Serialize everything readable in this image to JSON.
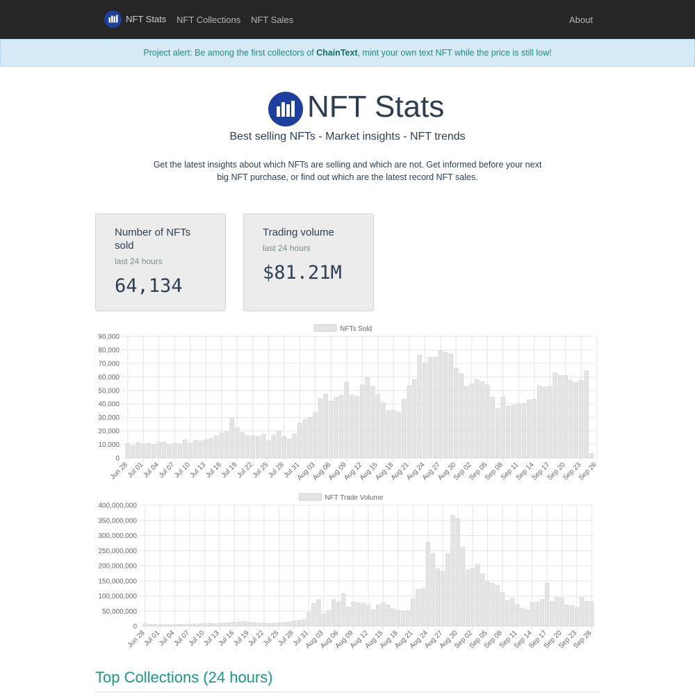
{
  "navbar": {
    "brand": "NFT Stats",
    "links": [
      "NFT Collections",
      "NFT Sales"
    ],
    "about": "About"
  },
  "alert": {
    "prefix": "Project alert: Be among the first collectors of ",
    "highlight": "ChainText",
    "suffix": ", mint your own text NFT while the price is still low!"
  },
  "hero": {
    "title": "NFT Stats",
    "subtitle": "Best selling NFTs - Market insights - NFT trends",
    "description": "Get the latest insights about which NFTs are selling and which are not. Get informed before your next big NFT purchase, or find out which are the latest record NFT sales."
  },
  "cards": [
    {
      "title": "Number of NFTs sold",
      "subtitle": "last 24 hours",
      "value": "64,134"
    },
    {
      "title": "Trading volume",
      "subtitle": "last 24 hours",
      "value": "$81.21M"
    }
  ],
  "colors": {
    "navbar": "#262626",
    "accent": "#18998a",
    "alert_bg": "#d5eaf6",
    "bar_fill": "#e4e4e4",
    "bar_stroke": "#d2d2d2"
  },
  "icons": {
    "brand": "bar-chart-logo-icon"
  },
  "chart_data": [
    {
      "type": "bar",
      "title": "",
      "legend": "NFTs Sold",
      "legend_position": "top",
      "grid": true,
      "ylim": [
        0,
        90000
      ],
      "yticks": [
        "90,000",
        "80,000",
        "70,000",
        "60,000",
        "50,000",
        "40,000",
        "30,000",
        "20,000",
        "10,000",
        "0"
      ],
      "xtick_labels": [
        "Jun 28",
        "Jul 01",
        "Jul 04",
        "Jul 07",
        "Jul 10",
        "Jul 13",
        "Jul 16",
        "Jul 19",
        "Jul 22",
        "Jul 25",
        "Jul 28",
        "Jul 31",
        "Aug 03",
        "Aug 06",
        "Aug 09",
        "Aug 12",
        "Aug 15",
        "Aug 18",
        "Aug 21",
        "Aug 24",
        "Aug 27",
        "Aug 30",
        "Sep 02",
        "Sep 05",
        "Sep 08",
        "Sep 11",
        "Sep 14",
        "Sep 17",
        "Sep 20",
        "Sep 23",
        "Sep 26"
      ],
      "values": [
        11000,
        9000,
        11500,
        10500,
        11000,
        10000,
        11500,
        11500,
        10000,
        11000,
        10500,
        13500,
        11000,
        13000,
        12500,
        13500,
        14500,
        16500,
        18500,
        19500,
        29500,
        22500,
        19000,
        16500,
        16500,
        16000,
        17500,
        13000,
        17000,
        20000,
        16000,
        14000,
        18000,
        26000,
        28500,
        30000,
        34000,
        44000,
        47500,
        42000,
        45000,
        46500,
        56000,
        46500,
        45500,
        54000,
        59500,
        53000,
        47000,
        41000,
        35000,
        35500,
        34000,
        43500,
        53500,
        58000,
        76000,
        70500,
        74500,
        74500,
        79500,
        78000,
        77000,
        66500,
        62500,
        53000,
        55000,
        58000,
        56500,
        54000,
        45000,
        36500,
        45000,
        38500,
        39000,
        40000,
        40500,
        43000,
        43500,
        53500,
        52500,
        53000,
        63000,
        61000,
        61000,
        57500,
        56000,
        57500,
        64500,
        3500
      ]
    },
    {
      "type": "bar",
      "title": "",
      "legend": "NFT Trade Volume",
      "legend_position": "top",
      "grid": true,
      "ylim": [
        0,
        400000000
      ],
      "yticks": [
        "400,000,000",
        "350,000,000",
        "300,000,000",
        "250,000,000",
        "200,000,000",
        "150,000,000",
        "100,000,000",
        "50,000,000",
        "0"
      ],
      "xtick_labels": [
        "Jun 28",
        "Jul 01",
        "Jul 04",
        "Jul 07",
        "Jul 10",
        "Jul 13",
        "Jul 16",
        "Jul 19",
        "Jul 22",
        "Jul 25",
        "Jul 28",
        "Jul 31",
        "Aug 03",
        "Aug 06",
        "Aug 09",
        "Aug 12",
        "Aug 15",
        "Aug 18",
        "Aug 21",
        "Aug 24",
        "Aug 27",
        "Aug 30",
        "Sep 02",
        "Sep 05",
        "Sep 08",
        "Sep 11",
        "Sep 14",
        "Sep 17",
        "Sep 20",
        "Sep 23",
        "Sep 26"
      ],
      "values": [
        8000000,
        6000000,
        6000000,
        5000000,
        5000000,
        5000000,
        6000000,
        6000000,
        6000000,
        7000000,
        7000000,
        8000000,
        9000000,
        10000000,
        9000000,
        10000000,
        11000000,
        12000000,
        13000000,
        15000000,
        16000000,
        13000000,
        12000000,
        10000000,
        10000000,
        9000000,
        10000000,
        11000000,
        12000000,
        14000000,
        18000000,
        20000000,
        22000000,
        45000000,
        75000000,
        88000000,
        42000000,
        52000000,
        88000000,
        80000000,
        108000000,
        64000000,
        80000000,
        77000000,
        76000000,
        70000000,
        55000000,
        70000000,
        78000000,
        70000000,
        57000000,
        52000000,
        50000000,
        51000000,
        90000000,
        122000000,
        125000000,
        278000000,
        240000000,
        190000000,
        182000000,
        240000000,
        366000000,
        356000000,
        262000000,
        187000000,
        192000000,
        205000000,
        173000000,
        148000000,
        142000000,
        135000000,
        112000000,
        85000000,
        92000000,
        72000000,
        60000000,
        55000000,
        80000000,
        80000000,
        88000000,
        142000000,
        82000000,
        96000000,
        95000000,
        70000000,
        68000000,
        62000000,
        96000000,
        82000000,
        82000000
      ]
    }
  ],
  "section": {
    "title": "Top Collections (24 hours)"
  }
}
